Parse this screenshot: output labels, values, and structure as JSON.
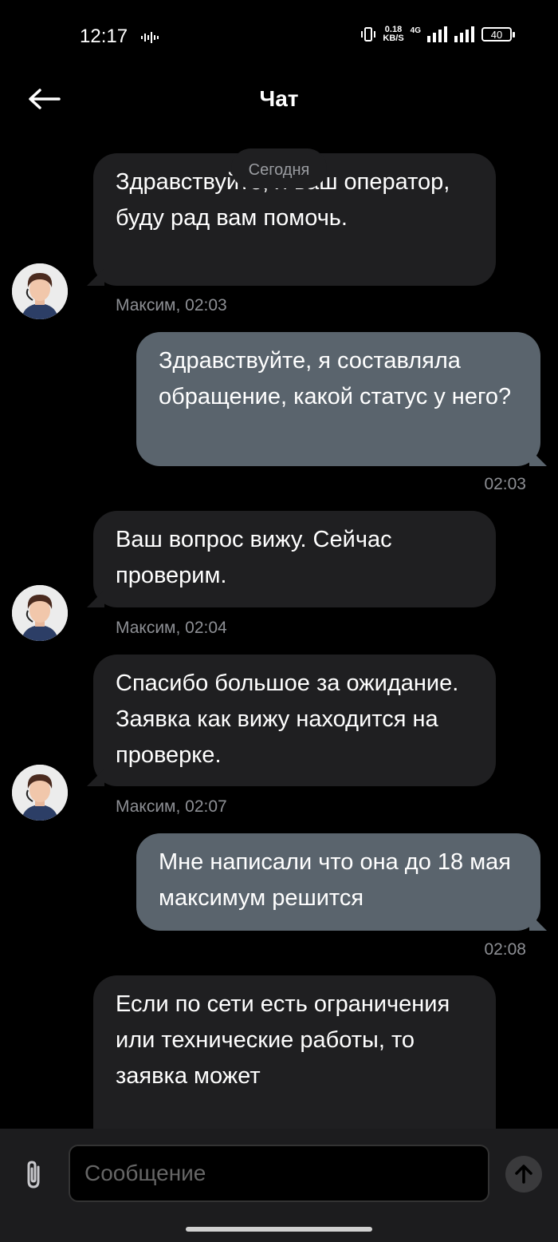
{
  "status_bar": {
    "time": "12:17",
    "net_speed": "0.18",
    "net_unit": "KB/S",
    "network": "4G",
    "battery": "40"
  },
  "header": {
    "title": "Чат"
  },
  "date_chip": "Сегодня",
  "messages": [
    {
      "direction": "incoming",
      "text": "Здравствуйте, я ваш оператор, буду рад вам помочь.",
      "meta": "Максим, 02:03"
    },
    {
      "direction": "outgoing",
      "text": "Здравствуйте, я составляла обращение, какой статус у него?",
      "meta": "02:03"
    },
    {
      "direction": "incoming",
      "text": "Ваш вопрос вижу. Сейчас проверим.",
      "meta": "Максим, 02:04"
    },
    {
      "direction": "incoming",
      "text": "Спасибо большое  за ожидание. Заявка как вижу находится на проверке.",
      "meta": "Максим, 02:07"
    },
    {
      "direction": "outgoing",
      "text": "Мне написали что она до 18 мая максимум решится",
      "meta": "02:08"
    },
    {
      "direction": "incoming",
      "text": "Если по сети есть ограничения или технические работы, то заявка может"
    }
  ],
  "composer": {
    "placeholder": "Сообщение"
  },
  "icons": {
    "back": "arrow-left-icon",
    "attach": "paperclip-icon",
    "send": "arrow-up-icon",
    "vibrate": "vibrate-icon",
    "signal": "signal-icon",
    "battery": "battery-icon"
  },
  "colors": {
    "background": "#000000",
    "incoming_bubble": "#1f1f21",
    "outgoing_bubble": "#5a646d",
    "meta_text": "#8d8f94"
  }
}
